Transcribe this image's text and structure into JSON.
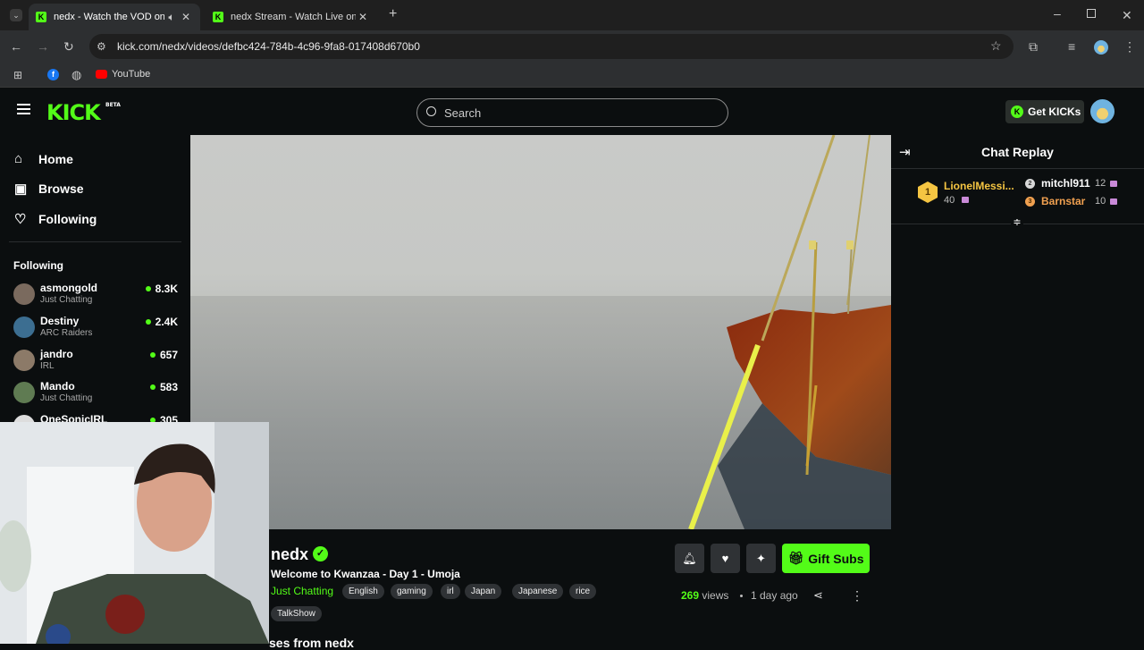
{
  "browser": {
    "tabs": [
      {
        "title": "nedx - Watch the VOD on Ki",
        "active": true
      },
      {
        "title": "nedx Stream - Watch Live on Ki",
        "active": false
      }
    ],
    "url": "kick.com/nedx/videos/defbc424-784b-4c96-9fa8-017408d670b0",
    "bookmarks": [
      {
        "label": "YouTube"
      }
    ]
  },
  "header": {
    "logo": "KICK",
    "logo_badge": "BETA",
    "search_placeholder": "Search",
    "get_kicks_label": "Get KICKs"
  },
  "sidebar": {
    "nav": [
      {
        "label": "Home",
        "icon": "home-icon"
      },
      {
        "label": "Browse",
        "icon": "browse-icon"
      },
      {
        "label": "Following",
        "icon": "heart-icon"
      }
    ],
    "following_title": "Following",
    "following": [
      {
        "name": "asmongold",
        "category": "Just Chatting",
        "viewers": "8.3K"
      },
      {
        "name": "Destiny",
        "category": "ARC Raiders",
        "viewers": "2.4K"
      },
      {
        "name": "jandro",
        "category": "IRL",
        "viewers": "657"
      },
      {
        "name": "Mando",
        "category": "Just Chatting",
        "viewers": "583"
      },
      {
        "name": "OneSonicIRL",
        "category": "",
        "viewers": "305"
      }
    ]
  },
  "stream": {
    "channel": "nedx",
    "title": "Welcome to Kwanzaa - Day 1 - Umoja",
    "category": "Just Chatting",
    "tags": [
      "English",
      "gaming",
      "irl",
      "Japan",
      "Japanese",
      "rice",
      "TalkShow"
    ],
    "views": "269",
    "views_label": "views",
    "age": "1 day ago",
    "gift_label": "Gift Subs",
    "more_from": "ses from nedx"
  },
  "chat": {
    "title": "Chat Replay",
    "leaders": [
      {
        "rank": "1",
        "name": "LionelMessi...",
        "value": "40"
      },
      {
        "rank": "2",
        "name": "mitchl911",
        "value": "12"
      },
      {
        "rank": "3",
        "name": "Barnstar",
        "value": "10"
      }
    ]
  },
  "colors": {
    "accent": "#53fc18",
    "gold": "#f5c542",
    "bronze": "#f0a050"
  }
}
